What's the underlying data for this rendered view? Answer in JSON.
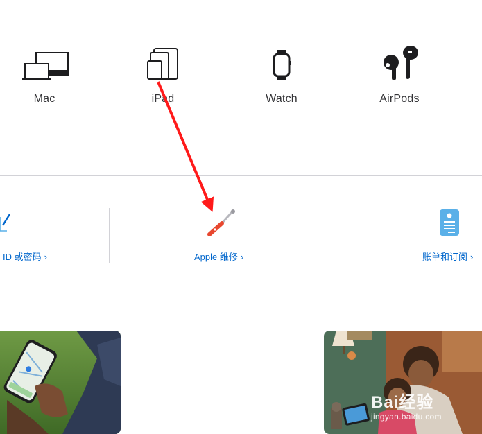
{
  "products": [
    {
      "label": "Mac",
      "icon": "mac-icon"
    },
    {
      "label": "iPad",
      "icon": "ipad-icon"
    },
    {
      "label": "Watch",
      "icon": "watch-icon"
    },
    {
      "label": "AirPods",
      "icon": "airpods-icon"
    }
  ],
  "services": {
    "id": {
      "label": "ID 或密码",
      "chevron": "›",
      "icon": "pencil-icon"
    },
    "repair": {
      "label": "Apple 维修",
      "chevron": "›",
      "icon": "wrench-screwdriver-icon"
    },
    "billing": {
      "label": "账单和订阅",
      "chevron": "›",
      "icon": "receipt-icon"
    }
  },
  "photos": [
    {
      "name": "person-holding-phone-map-photo"
    },
    {
      "name": "mother-child-ipad-photo"
    }
  ],
  "watermark": {
    "text": "Bai经验",
    "url": "jingyan.baidu.com"
  },
  "annotation": {
    "type": "red-arrow",
    "color": "#ff1a1a"
  },
  "colors": {
    "link": "#0066cc",
    "text": "#333336",
    "divider": "#d2d2d7",
    "repair_icon": "#e8472f",
    "billing_icon": "#5ab0e8"
  }
}
